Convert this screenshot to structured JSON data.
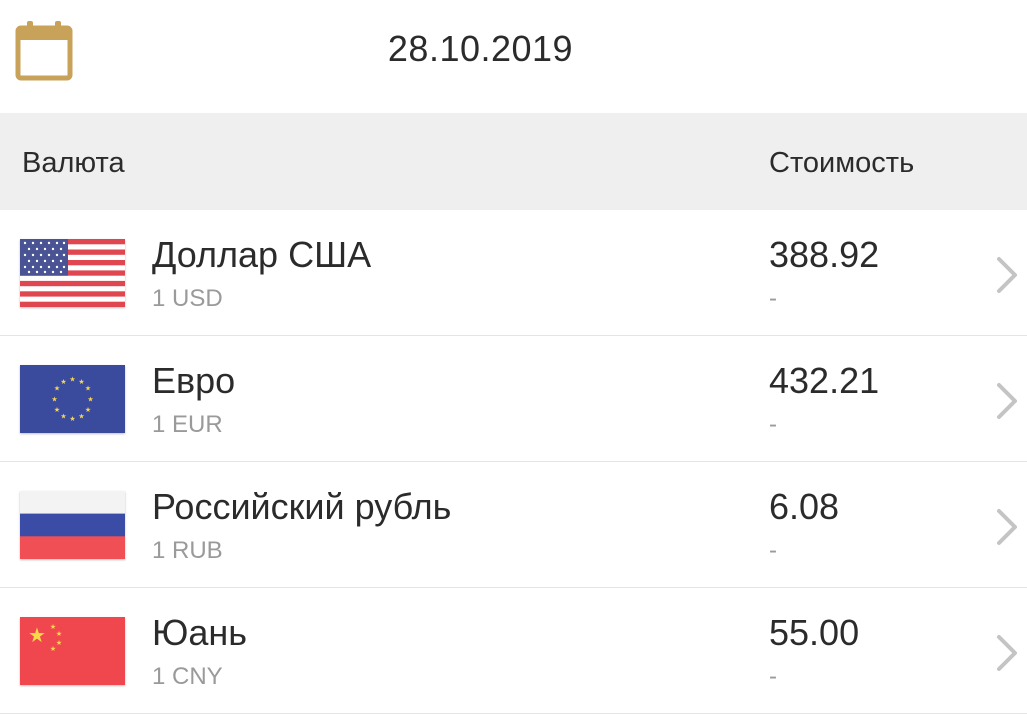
{
  "header": {
    "calendar_icon": "calendar-icon",
    "date": "28.10.2019",
    "accent_color": "#c9a25a"
  },
  "columns": {
    "currency": "Валюта",
    "price": "Стоимость"
  },
  "rows": [
    {
      "name": "Доллар США",
      "unit": "1 USD",
      "price": "388.92",
      "change": "-",
      "flag": "us-flag-icon"
    },
    {
      "name": "Евро",
      "unit": "1 EUR",
      "price": "432.21",
      "change": "-",
      "flag": "eu-flag-icon"
    },
    {
      "name": "Российский рубль",
      "unit": "1 RUB",
      "price": "6.08",
      "change": "-",
      "flag": "ru-flag-icon"
    },
    {
      "name": "Юань",
      "unit": "1 CNY",
      "price": "55.00",
      "change": "-",
      "flag": "cn-flag-icon"
    }
  ]
}
